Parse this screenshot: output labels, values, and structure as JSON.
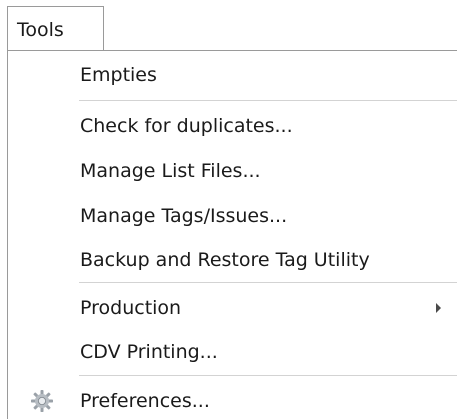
{
  "menubar": {
    "tools_label": "Tools"
  },
  "menu": {
    "items": [
      {
        "label": "Empties"
      },
      {
        "label": "Check for duplicates..."
      },
      {
        "label": "Manage List Files..."
      },
      {
        "label": "Manage Tags/Issues..."
      },
      {
        "label": "Backup and Restore Tag Utility"
      },
      {
        "label": "Production"
      },
      {
        "label": "CDV Printing..."
      },
      {
        "label": "Preferences...",
        "icon": "gear-icon"
      }
    ]
  }
}
